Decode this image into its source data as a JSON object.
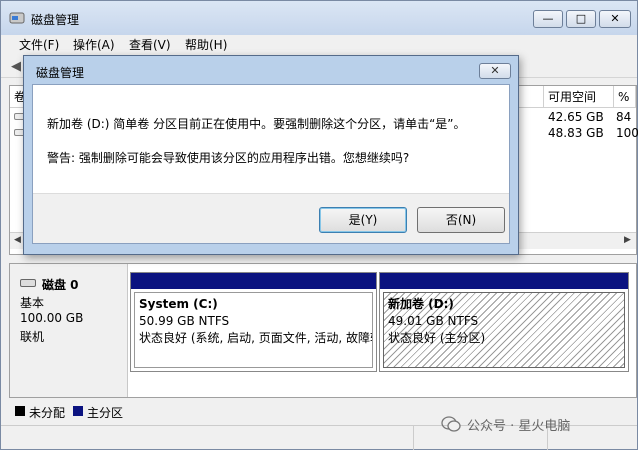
{
  "window": {
    "title": "磁盘管理"
  },
  "window_buttons": {
    "min": "—",
    "max": "□",
    "close": "✕"
  },
  "menu": [
    {
      "label": "文件(F)"
    },
    {
      "label": "操作(A)"
    },
    {
      "label": "查看(V)"
    },
    {
      "label": "帮助(H)"
    }
  ],
  "volume_list": {
    "first_col_header": "卷",
    "headers": {
      "free": "可用空间",
      "pct": "%"
    },
    "rows": [
      {
        "free": "42.65 GB",
        "pct": "84"
      },
      {
        "free": "48.83 GB",
        "pct": "100"
      }
    ]
  },
  "disk": {
    "name": "磁盘 0",
    "type": "基本",
    "size": "100.00 GB",
    "status": "联机",
    "partitions": [
      {
        "name": "System  (C:)",
        "size": "50.99 GB NTFS",
        "status": "状态良好 (系统, 启动, 页面文件, 活动, 故障转"
      },
      {
        "name": "新加卷  (D:)",
        "size": "49.01 GB NTFS",
        "status": "状态良好 (主分区)"
      }
    ]
  },
  "legend": [
    {
      "label": "未分配",
      "color": "#000000"
    },
    {
      "label": "主分区",
      "color": "#0b1380"
    }
  ],
  "watermark": "公众号 · 星火电脑",
  "dialog": {
    "title": "磁盘管理",
    "close": "✕",
    "message": "新加卷 (D:) 简单卷 分区目前正在使用中。要强制删除这个分区，请单击“是”。",
    "warning": "警告: 强制删除可能会导致使用该分区的应用程序出错。您想继续吗?",
    "yes_label": "是(Y)",
    "no_label": "否(N)"
  }
}
